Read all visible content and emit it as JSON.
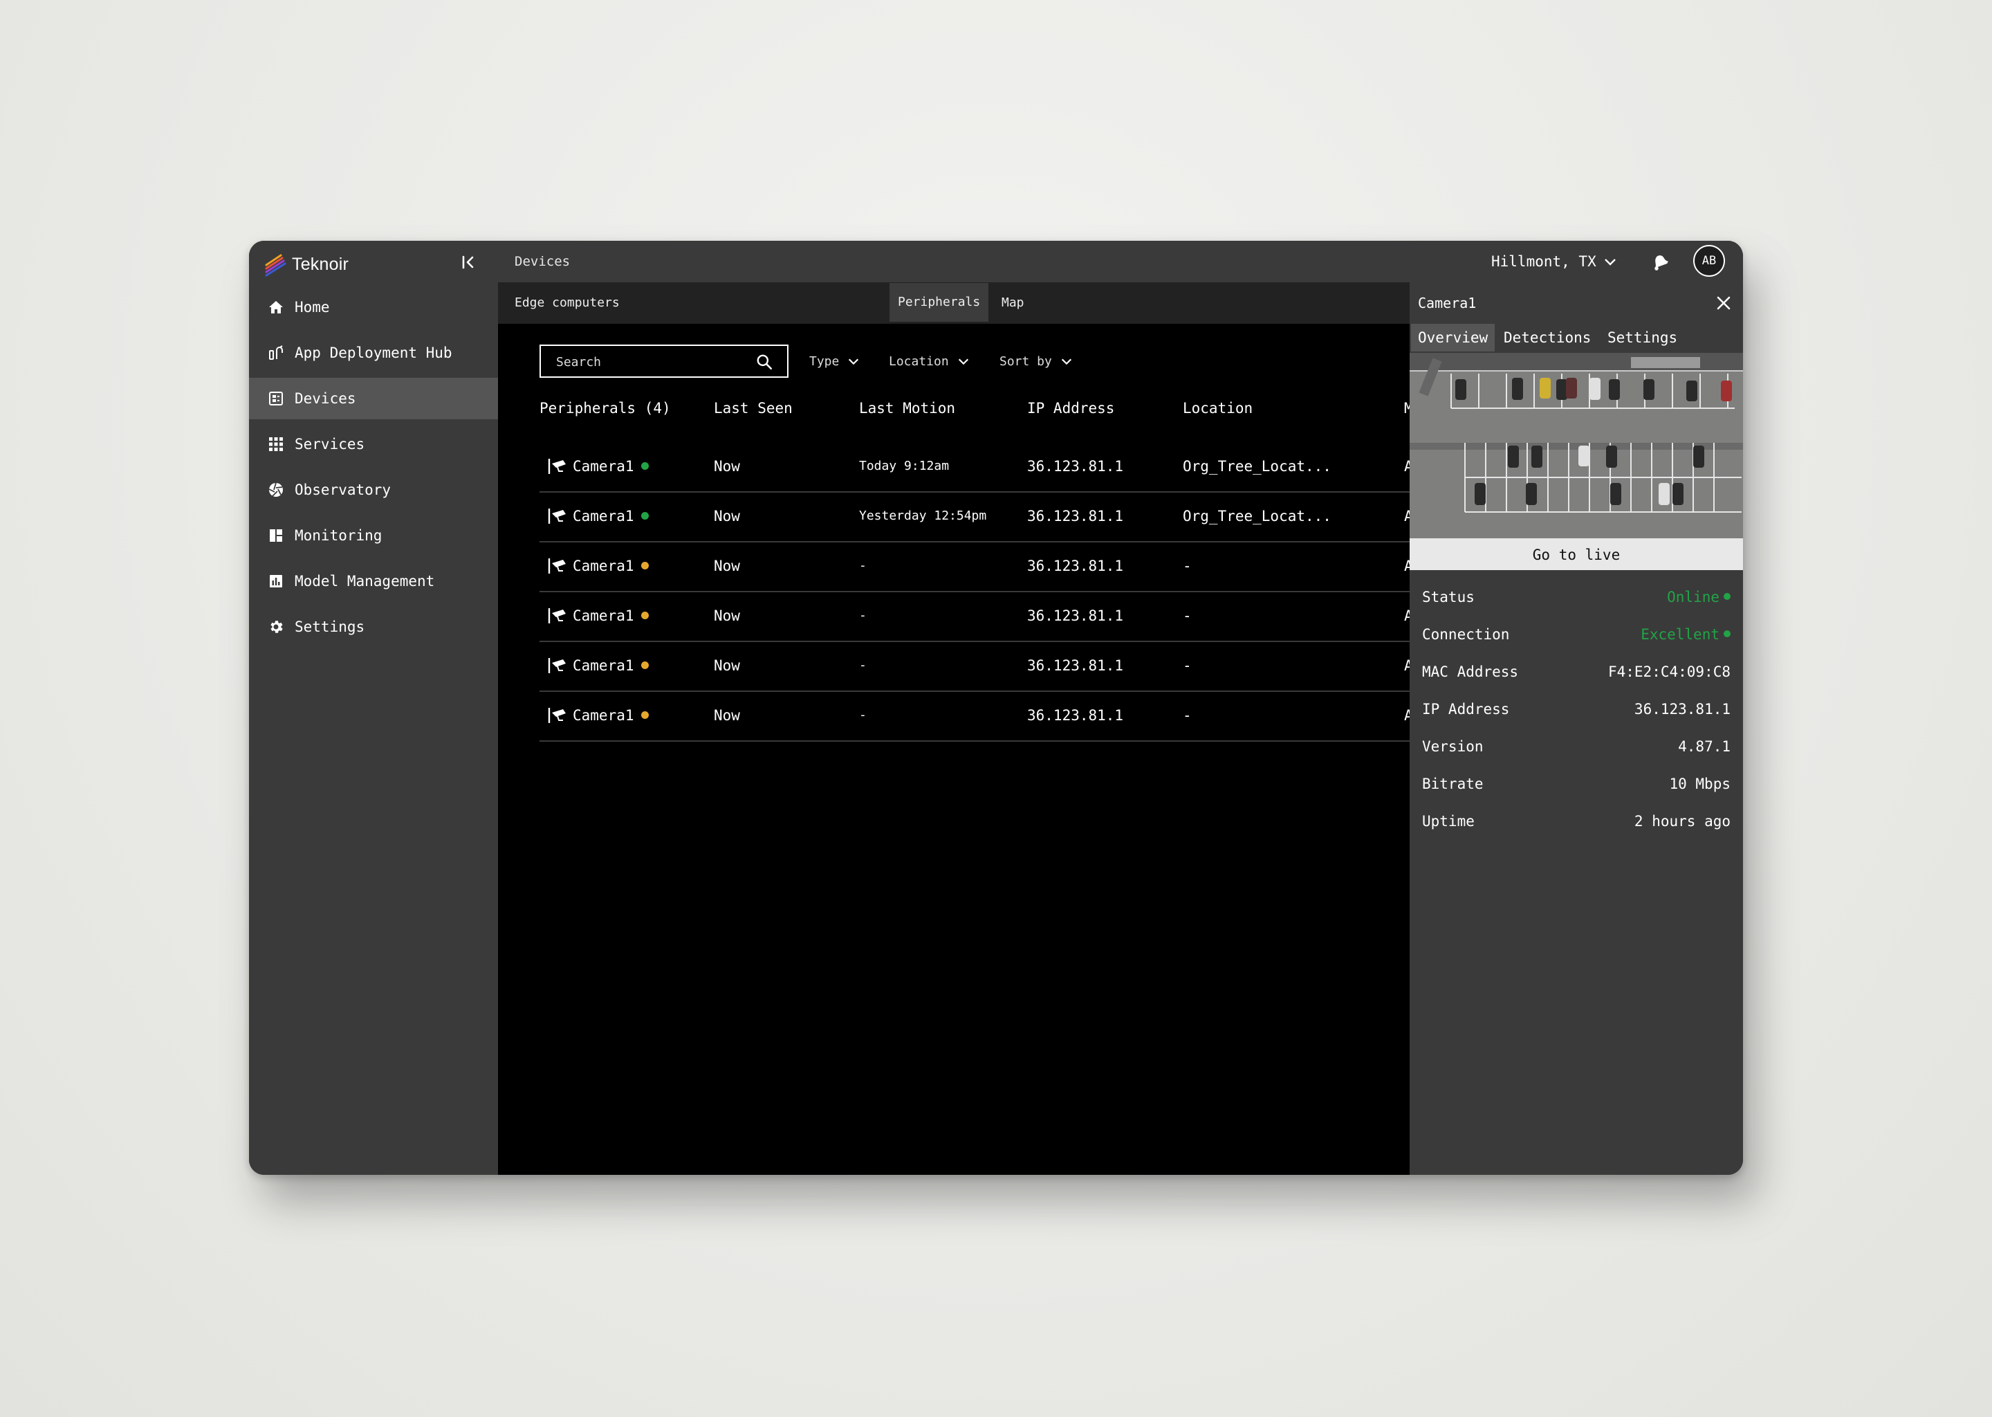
{
  "app": {
    "brand": "Teknoir"
  },
  "sidebar": {
    "items": [
      {
        "label": "Home",
        "icon": "home-icon"
      },
      {
        "label": "App Deployment Hub",
        "icon": "deploy-icon"
      },
      {
        "label": "Devices",
        "icon": "devices-icon",
        "active": true
      },
      {
        "label": "Services",
        "icon": "grid-icon"
      },
      {
        "label": "Observatory",
        "icon": "aperture-icon"
      },
      {
        "label": "Monitoring",
        "icon": "dashboard-icon"
      },
      {
        "label": "Model Management",
        "icon": "bar-chart-icon"
      },
      {
        "label": "Settings",
        "icon": "gear-icon"
      }
    ]
  },
  "topbar": {
    "breadcrumb": "Devices",
    "location": "Hillmont, TX",
    "avatar": "AB"
  },
  "tabs": [
    "Edge computers",
    "Peripherals",
    "Map"
  ],
  "toolbar": {
    "search_placeholder": "Search",
    "filters": [
      "Type",
      "Location",
      "Sort by"
    ]
  },
  "table": {
    "columns": [
      "Peripherals (4)",
      "Last Seen",
      "Last Motion",
      "IP Address",
      "Location",
      "M"
    ],
    "rows": [
      {
        "name": "Camera1",
        "status": "online",
        "last_seen": "Now",
        "last_motion": "Today 9:12am",
        "ip": "36.123.81.1",
        "location": "Org_Tree_Locat...",
        "extra": "A"
      },
      {
        "name": "Camera1",
        "status": "online",
        "last_seen": "Now",
        "last_motion": "Yesterday 12:54pm",
        "ip": "36.123.81.1",
        "location": "Org_Tree_Locat...",
        "extra": "A"
      },
      {
        "name": "Camera1",
        "status": "warning",
        "last_seen": "Now",
        "last_motion": "-",
        "ip": "36.123.81.1",
        "location": "-",
        "extra": "A"
      },
      {
        "name": "Camera1",
        "status": "warning",
        "last_seen": "Now",
        "last_motion": "-",
        "ip": "36.123.81.1",
        "location": "-",
        "extra": "A"
      },
      {
        "name": "Camera1",
        "status": "warning",
        "last_seen": "Now",
        "last_motion": "-",
        "ip": "36.123.81.1",
        "location": "-",
        "extra": "A"
      },
      {
        "name": "Camera1",
        "status": "warning",
        "last_seen": "Now",
        "last_motion": "-",
        "ip": "36.123.81.1",
        "location": "-",
        "extra": "A"
      }
    ]
  },
  "colors": {
    "online": "#22a347",
    "warning": "#e6a82c"
  },
  "panel": {
    "title": "Camera1",
    "tabs": [
      "Overview",
      "Detections",
      "Settings"
    ],
    "go_live": "Go to live",
    "properties": [
      {
        "key": "Status",
        "value": "Online",
        "highlight": true
      },
      {
        "key": "Connection",
        "value": "Excellent",
        "highlight": true
      },
      {
        "key": "MAC Address",
        "value": "F4:E2:C4:09:C8"
      },
      {
        "key": "IP Address",
        "value": "36.123.81.1"
      },
      {
        "key": "Version",
        "value": "4.87.1"
      },
      {
        "key": "Bitrate",
        "value": "10 Mbps"
      },
      {
        "key": "Uptime",
        "value": "2 hours ago"
      }
    ]
  }
}
